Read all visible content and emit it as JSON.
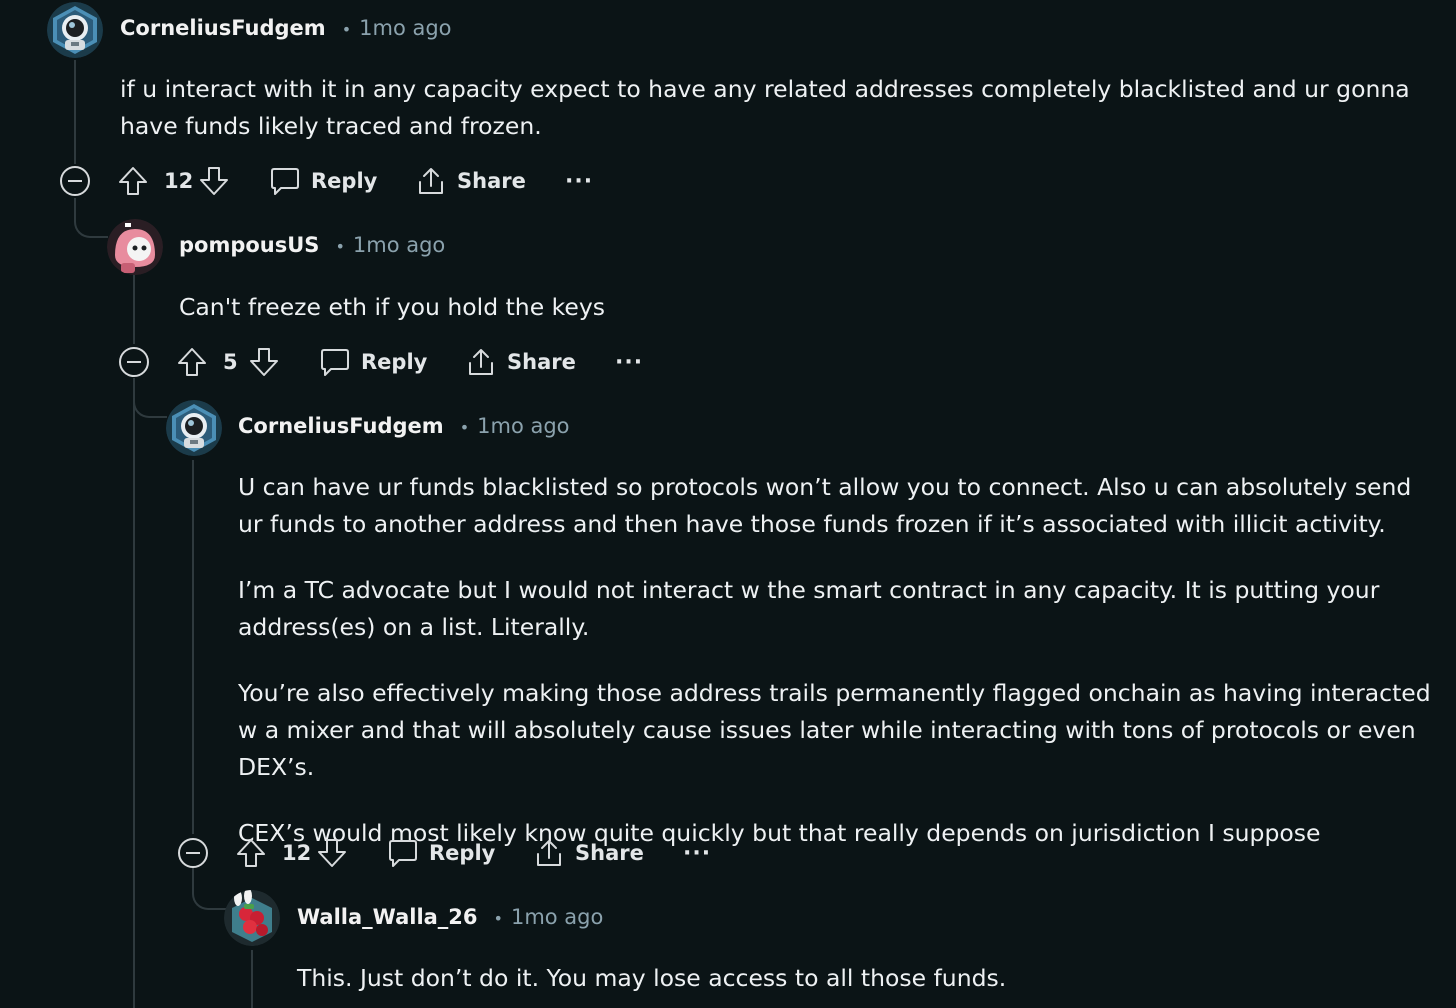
{
  "comments": [
    {
      "username": "CorneliusFudgem",
      "separator": "•",
      "time": "1mo ago",
      "avatar_icon": "astronaut-avatar-icon",
      "paragraphs": [
        "if u interact with it in any capacity expect to have any related addresses completely blacklisted and ur gonna have funds likely traced and frozen."
      ],
      "score": "12",
      "reply_label": "Reply",
      "share_label": "Share",
      "more_label": "···"
    },
    {
      "username": "pompousUS",
      "separator": "•",
      "time": "1mo ago",
      "avatar_icon": "pink-hood-character-avatar-icon",
      "paragraphs": [
        "Can't freeze eth if you hold the keys"
      ],
      "score": "5",
      "reply_label": "Reply",
      "share_label": "Share",
      "more_label": "···"
    },
    {
      "username": "CorneliusFudgem",
      "separator": "•",
      "time": "1mo ago",
      "avatar_icon": "astronaut-avatar-icon",
      "paragraphs": [
        "U can have ur funds blacklisted so protocols won’t allow you to connect. Also u can absolutely send ur funds to another address and then have those funds frozen if it’s associated with illicit activity.",
        "I’m a TC advocate but I would not interact w the smart contract in any capacity. It is putting your address(es) on a list. Literally.",
        "You’re also effectively making those address trails permanently flagged onchain as having interacted w a mixer and that will absolutely cause issues later while interacting with tons of protocols or even DEX’s.",
        "CEX’s would most likely know quite quickly but that really depends on jurisdiction I suppose"
      ],
      "score": "12",
      "reply_label": "Reply",
      "share_label": "Share",
      "more_label": "···"
    },
    {
      "username": "Walla_Walla_26",
      "separator": "•",
      "time": "1mo ago",
      "avatar_icon": "strawberry-bunny-avatar-icon",
      "paragraphs": [
        "This. Just don’t do it. You may lose access to all those funds."
      ]
    }
  ],
  "colors": {
    "background": "#0b1416",
    "thread_line": "#2f3a3e",
    "username": "#f2f2f2",
    "meta": "#8ba2ad",
    "body_text": "#eef1f3"
  },
  "icons": {
    "collapse": "collapse-minus-icon",
    "upvote": "upvote-arrow-icon",
    "downvote": "downvote-arrow-icon",
    "reply": "reply-speech-bubble-icon",
    "share": "share-upload-icon"
  }
}
